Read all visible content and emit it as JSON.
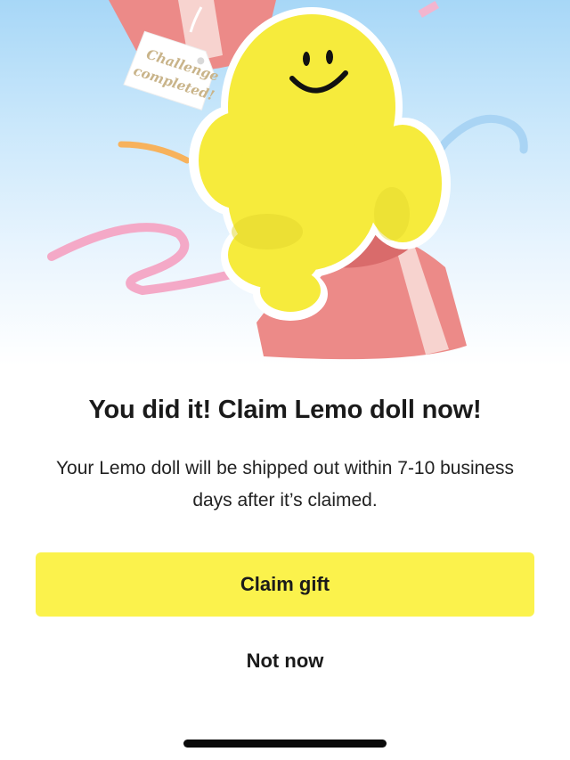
{
  "hero": {
    "tag_line1": "Challenge",
    "tag_line2": "completed!",
    "colors": {
      "sky_top": "#a7d7f7",
      "doll_yellow": "#f6eb3c",
      "gift_red": "#ec8a88",
      "ribbon_pink": "#f4a9c7",
      "ribbon_blue": "#a9d4f4",
      "ribbon_orange": "#f7b25c"
    }
  },
  "dialog": {
    "title": "You did it! Claim Lemo doll now!",
    "body": "Your Lemo doll will be shipped out within 7-10 business days after it’s claimed.",
    "primary_label": "Claim gift",
    "secondary_label": "Not now"
  },
  "theme": {
    "accent": "#fbf24c",
    "text": "#1a1a1a"
  }
}
